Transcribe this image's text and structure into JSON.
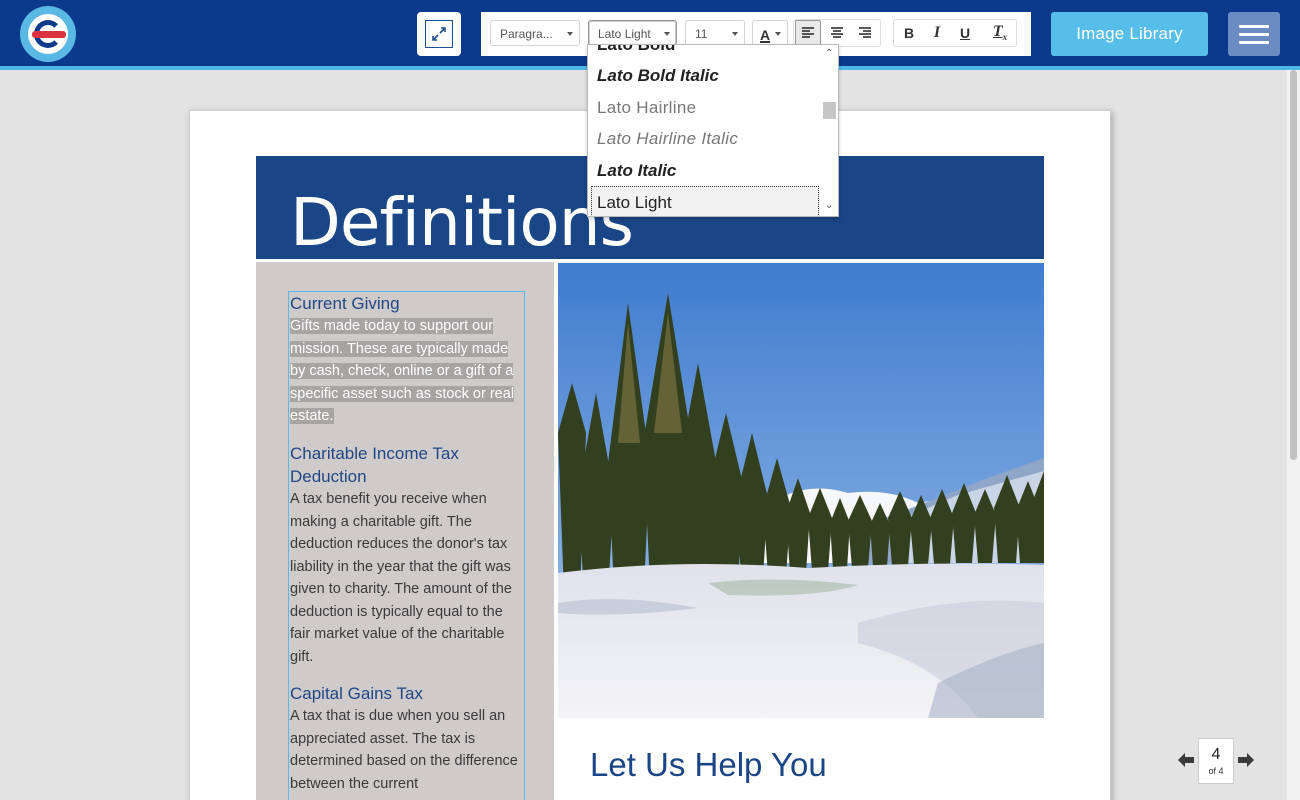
{
  "header": {
    "logo_letter": "e",
    "image_library_label": "Image Library"
  },
  "toolbar": {
    "paragraph_style": "Paragra...",
    "font_family": "Lato Light",
    "font_size": "11",
    "text_color_glyph": "A",
    "bold": "B",
    "italic": "I",
    "underline": "U",
    "clear_format": "T",
    "clear_format_sub": "x",
    "align_left_active": true
  },
  "font_dropdown": {
    "items": [
      {
        "label": "Lato Bold",
        "style": "bold"
      },
      {
        "label": "Lato Bold Italic",
        "style": "bold-italic"
      },
      {
        "label": "Lato Hairline",
        "style": "hairline"
      },
      {
        "label": "Lato Hairline Italic",
        "style": "hairline-italic"
      },
      {
        "label": "Lato Italic",
        "style": "italic"
      },
      {
        "label": "Lato Light",
        "style": "light"
      }
    ],
    "selected": "Lato Light"
  },
  "page": {
    "title": "Definitions",
    "definitions": [
      {
        "term": "Current Giving",
        "text": "Gifts made today to support our mission. These are typically made by cash, check, online or a gift of a specific asset such as stock or real estate."
      },
      {
        "term": "Charitable Income Tax Deduction",
        "text": "A tax benefit you receive when making a charitable gift. The deduction reduces the donor's tax liability in the year that the gift was given to charity. The amount of the deduction is typically equal to the fair market value of the charitable gift."
      },
      {
        "term": "Capital Gains Tax",
        "text": "A tax that is due when you sell an appreciated asset. The tax is determined based on the difference between the current"
      }
    ],
    "help_heading": "Let Us Help You"
  },
  "pager": {
    "current": "4",
    "total_label": "of 4"
  },
  "colors": {
    "topbar": "#0b3a8c",
    "accent": "#56bee9",
    "banner": "#1a4586",
    "sidebar": "#cfcbcb"
  }
}
